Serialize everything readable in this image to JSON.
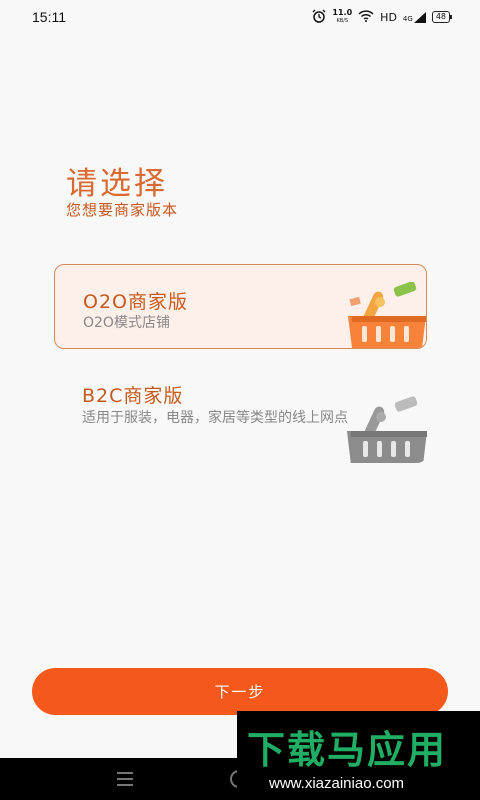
{
  "status_bar": {
    "time": "15:11",
    "speed_value": "11.0",
    "speed_unit": "KB/S",
    "hd": "HD",
    "network": "4G",
    "battery": "48"
  },
  "header": {
    "title": "请选择",
    "subtitle": "您想要商家版本"
  },
  "options": [
    {
      "title": "O2O商家版",
      "desc": "O2O模式店铺",
      "selected": true,
      "basket_color": "orange"
    },
    {
      "title": "B2C商家版",
      "desc": "适用于服装，电器，家居等类型的线上网点",
      "selected": false,
      "basket_color": "gray"
    }
  ],
  "next_button": {
    "label": "下一步"
  },
  "watermark": {
    "text": "下载马应用",
    "url": "www.xiazainiao.com"
  },
  "colors": {
    "accent": "#f4581a",
    "title": "#d9692f",
    "selected_card_bg": "#fdf0eb"
  }
}
